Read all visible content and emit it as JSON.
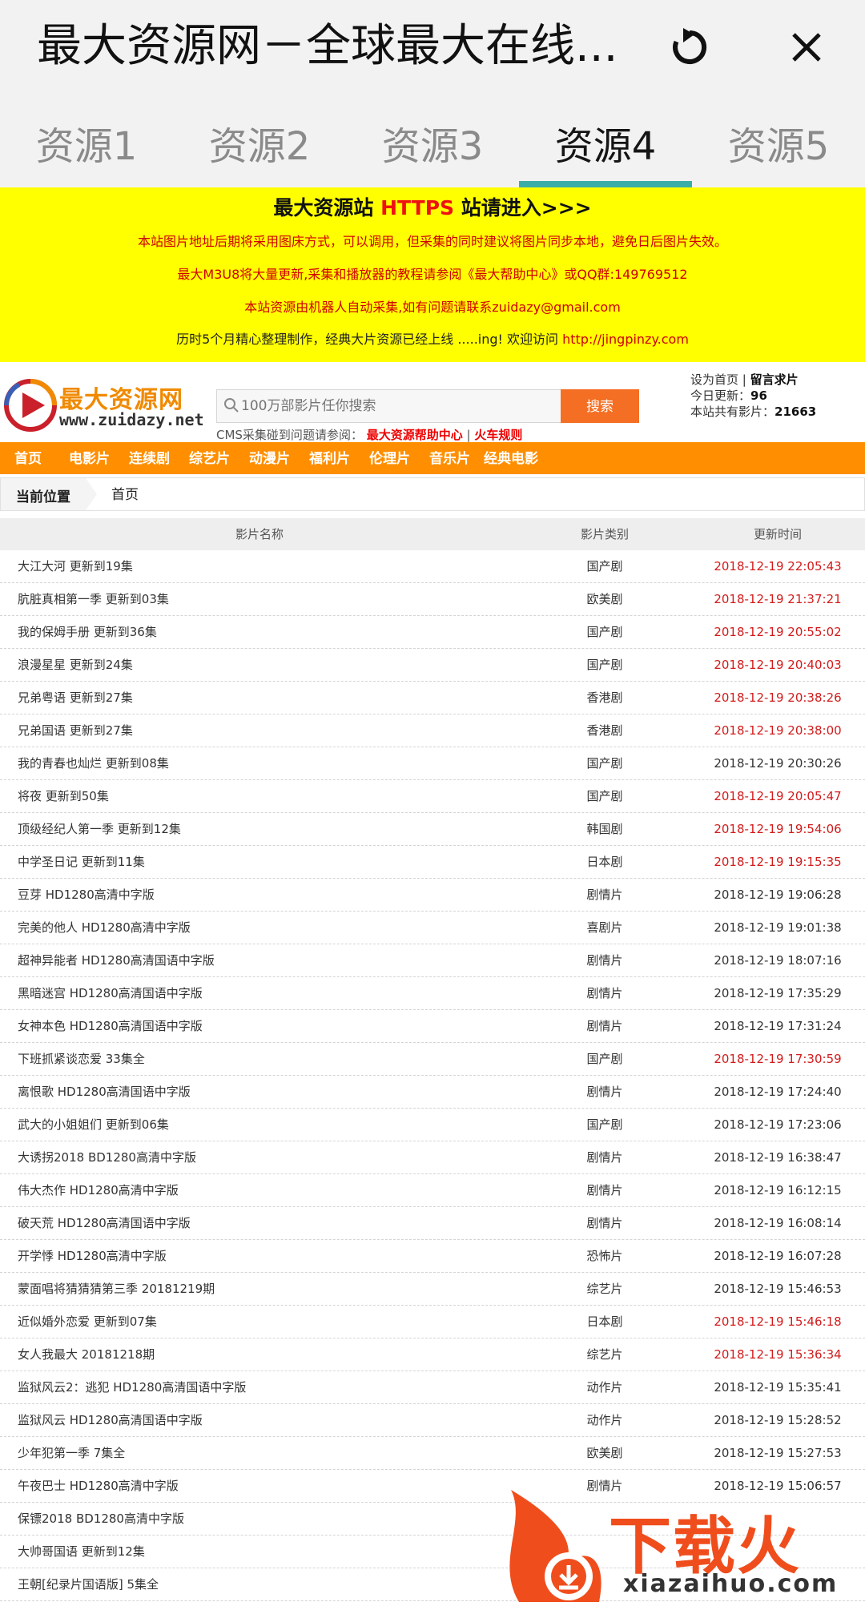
{
  "app": {
    "title": "最大资源网－全球最大在线...",
    "refresh_icon": "refresh-icon",
    "close_icon": "close-icon"
  },
  "tabs": [
    {
      "label": "资源1"
    },
    {
      "label": "资源2"
    },
    {
      "label": "资源3"
    },
    {
      "label": "资源4",
      "active": true
    },
    {
      "label": "资源5"
    }
  ],
  "notice": {
    "head_pre": "最大资源站 ",
    "head_red": "HTTPS",
    "head_post": " 站请进入>>>",
    "line1": "本站图片地址后期将采用图床方式，可以调用，但采集的同时建议将图片同步本地，避免日后图片失效。",
    "line2": "最大M3U8将大量更新,采集和播放器的教程请参阅《最大帮助中心》或QQ群:149769512",
    "line3": "本站资源由机器人自动采集,如有问题请联系zuidazy@gmail.com",
    "line4_text": "历时5个月精心整理制作，经典大片资源已经上线 .....ing! 欢迎访问 ",
    "line4_link": "http://jingpinzy.com"
  },
  "header": {
    "logo_text": "最大资源网",
    "logo_url": "www.zuidazy.net",
    "search_placeholder": "100万部影片任你搜索",
    "search_button": "搜索",
    "help_prefix": "CMS采集碰到问题请参阅：",
    "help_link1": "最大资源帮助中心",
    "help_sep": " | ",
    "help_link2": "火车规则",
    "set_home": "设为首页",
    "info_sep": " | ",
    "request": "留言求片",
    "today_label": "今日更新：",
    "today_count": "96",
    "total_label": "本站共有影片：",
    "total_count": "21663"
  },
  "nav": [
    "首页",
    "电影片",
    "连续剧",
    "综艺片",
    "动漫片",
    "福利片",
    "伦理片",
    "音乐片",
    "经典电影"
  ],
  "breadcrumb": {
    "label": "当前位置",
    "current": "首页"
  },
  "table": {
    "headers": {
      "name": "影片名称",
      "category": "影片类别",
      "time": "更新时间"
    },
    "rows": [
      {
        "name": "大江大河 更新到19集",
        "category": "国产剧",
        "time": "2018-12-19 22:05:43",
        "highlight": true
      },
      {
        "name": "肮脏真相第一季 更新到03集",
        "category": "欧美剧",
        "time": "2018-12-19 21:37:21",
        "highlight": true
      },
      {
        "name": "我的保姆手册 更新到36集",
        "category": "国产剧",
        "time": "2018-12-19 20:55:02",
        "highlight": true
      },
      {
        "name": "浪漫星星 更新到24集",
        "category": "国产剧",
        "time": "2018-12-19 20:40:03",
        "highlight": true
      },
      {
        "name": "兄弟粤语 更新到27集",
        "category": "香港剧",
        "time": "2018-12-19 20:38:26",
        "highlight": true
      },
      {
        "name": "兄弟国语 更新到27集",
        "category": "香港剧",
        "time": "2018-12-19 20:38:00",
        "highlight": true
      },
      {
        "name": "我的青春也灿烂 更新到08集",
        "category": "国产剧",
        "time": "2018-12-19 20:30:26",
        "highlight": false
      },
      {
        "name": "将夜 更新到50集",
        "category": "国产剧",
        "time": "2018-12-19 20:05:47",
        "highlight": true
      },
      {
        "name": "顶级经纪人第一季 更新到12集",
        "category": "韩国剧",
        "time": "2018-12-19 19:54:06",
        "highlight": true
      },
      {
        "name": "中学圣日记 更新到11集",
        "category": "日本剧",
        "time": "2018-12-19 19:15:35",
        "highlight": true
      },
      {
        "name": "豆芽 HD1280高清中字版",
        "category": "剧情片",
        "time": "2018-12-19 19:06:28",
        "highlight": false
      },
      {
        "name": "完美的他人 HD1280高清中字版",
        "category": "喜剧片",
        "time": "2018-12-19 19:01:38",
        "highlight": false
      },
      {
        "name": "超神异能者 HD1280高清国语中字版",
        "category": "剧情片",
        "time": "2018-12-19 18:07:16",
        "highlight": false
      },
      {
        "name": "黑暗迷宫 HD1280高清国语中字版",
        "category": "剧情片",
        "time": "2018-12-19 17:35:29",
        "highlight": false
      },
      {
        "name": "女神本色 HD1280高清国语中字版",
        "category": "剧情片",
        "time": "2018-12-19 17:31:24",
        "highlight": false
      },
      {
        "name": "下班抓紧谈恋爱 33集全",
        "category": "国产剧",
        "time": "2018-12-19 17:30:59",
        "highlight": true
      },
      {
        "name": "离恨歌 HD1280高清国语中字版",
        "category": "剧情片",
        "time": "2018-12-19 17:24:40",
        "highlight": false
      },
      {
        "name": "武大的小姐姐们 更新到06集",
        "category": "国产剧",
        "time": "2018-12-19 17:23:06",
        "highlight": false
      },
      {
        "name": "大诱拐2018 BD1280高清中字版",
        "category": "剧情片",
        "time": "2018-12-19 16:38:47",
        "highlight": false
      },
      {
        "name": "伟大杰作 HD1280高清中字版",
        "category": "剧情片",
        "time": "2018-12-19 16:12:15",
        "highlight": false
      },
      {
        "name": "破天荒 HD1280高清国语中字版",
        "category": "剧情片",
        "time": "2018-12-19 16:08:14",
        "highlight": false
      },
      {
        "name": "开学悸 HD1280高清中字版",
        "category": "恐怖片",
        "time": "2018-12-19 16:07:28",
        "highlight": false
      },
      {
        "name": "蒙面唱将猜猜猜第三季 20181219期",
        "category": "综艺片",
        "time": "2018-12-19 15:46:53",
        "highlight": false
      },
      {
        "name": "近似婚外恋爱 更新到07集",
        "category": "日本剧",
        "time": "2018-12-19 15:46:18",
        "highlight": true
      },
      {
        "name": "女人我最大 20181218期",
        "category": "综艺片",
        "time": "2018-12-19 15:36:34",
        "highlight": true
      },
      {
        "name": "监狱风云2：逃犯 HD1280高清国语中字版",
        "category": "动作片",
        "time": "2018-12-19 15:35:41",
        "highlight": false
      },
      {
        "name": "监狱风云 HD1280高清国语中字版",
        "category": "动作片",
        "time": "2018-12-19 15:28:52",
        "highlight": false
      },
      {
        "name": "少年犯第一季 7集全",
        "category": "欧美剧",
        "time": "2018-12-19 15:27:53",
        "highlight": false
      },
      {
        "name": "午夜巴士 HD1280高清中字版",
        "category": "剧情片",
        "time": "2018-12-19 15:06:57",
        "highlight": false
      },
      {
        "name": "保镖2018 BD1280高清中字版",
        "category": "",
        "time": "",
        "highlight": false
      },
      {
        "name": "大帅哥国语 更新到12集",
        "category": "",
        "time": "",
        "highlight": false
      },
      {
        "name": "王朝[纪录片国语版] 5集全",
        "category": "",
        "time": "",
        "highlight": false
      }
    ]
  },
  "watermark": {
    "text": "下载火",
    "url": "xiazaihuo.com"
  },
  "colors": {
    "accent": "#3aada6",
    "nav": "#ff8f00",
    "notice_bg": "#ffff00",
    "button": "#f46f23",
    "red": "#d21b1b"
  }
}
